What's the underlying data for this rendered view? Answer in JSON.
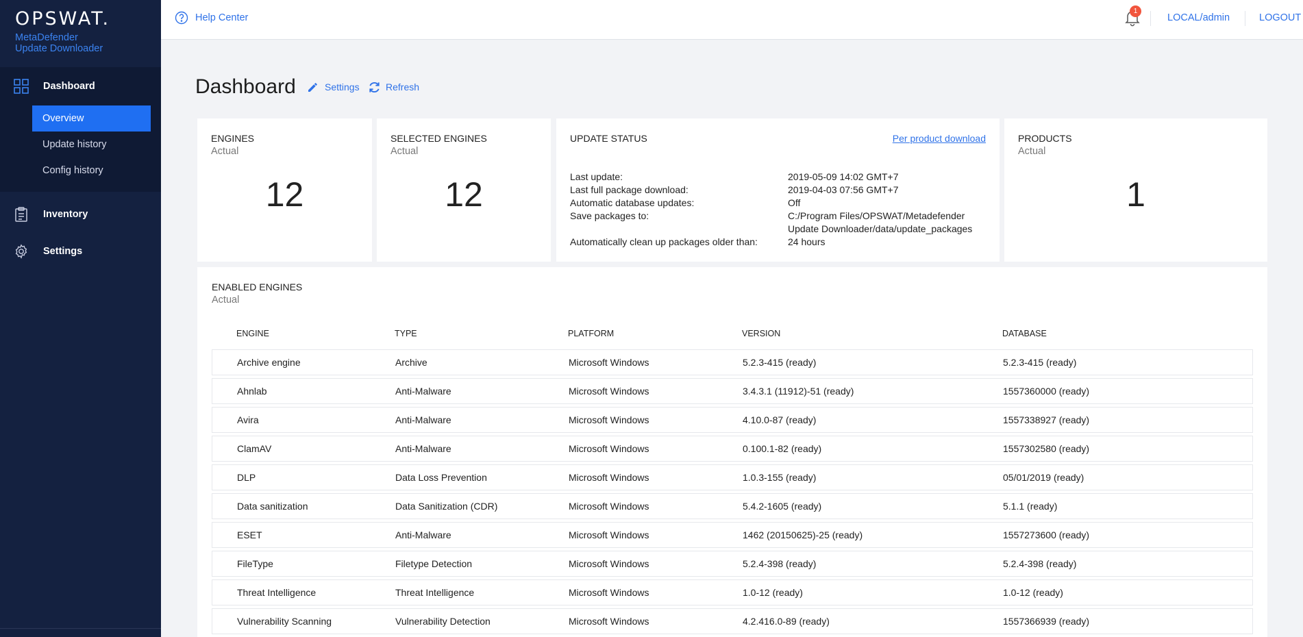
{
  "sidebar": {
    "logo": "OPSWAT.",
    "product_line1": "MetaDefender",
    "product_line2": "Update Downloader",
    "dashboard": "Dashboard",
    "sub_items": [
      "Overview",
      "Update history",
      "Config history"
    ],
    "inventory": "Inventory",
    "settings": "Settings"
  },
  "header": {
    "help": "Help Center",
    "notification_count": "1",
    "user": "LOCAL/admin",
    "logout": "LOGOUT"
  },
  "page": {
    "title": "Dashboard",
    "settings_action": "Settings",
    "refresh_action": "Refresh"
  },
  "cards": {
    "engines": {
      "title": "ENGINES",
      "sub": "Actual",
      "value": "12"
    },
    "selected": {
      "title": "SELECTED ENGINES",
      "sub": "Actual",
      "value": "12"
    },
    "update_status": {
      "title": "UPDATE STATUS",
      "link": "Per product download",
      "rows": [
        {
          "label": "Last update:",
          "value": "2019-05-09 14:02 GMT+7"
        },
        {
          "label": "Last full package download:",
          "value": "2019-04-03 07:56 GMT+7"
        },
        {
          "label": "Automatic database updates:",
          "value": "Off"
        },
        {
          "label": "Save packages to:",
          "value": "C:/Program Files/OPSWAT/Metadefender"
        },
        {
          "label": "",
          "value": "Update Downloader/data/update_packages"
        },
        {
          "label": "Automatically clean up packages older than:",
          "value": "24 hours"
        }
      ]
    },
    "products": {
      "title": "PRODUCTS",
      "sub": "Actual",
      "value": "1"
    }
  },
  "enabled_engines": {
    "title": "ENABLED ENGINES",
    "sub": "Actual",
    "columns": [
      "ENGINE",
      "TYPE",
      "PLATFORM",
      "VERSION",
      "DATABASE"
    ],
    "rows": [
      [
        "Archive engine",
        "Archive",
        "Microsoft Windows",
        "5.2.3-415 (ready)",
        "5.2.3-415 (ready)"
      ],
      [
        "Ahnlab",
        "Anti-Malware",
        "Microsoft Windows",
        "3.4.3.1 (11912)-51 (ready)",
        "1557360000 (ready)"
      ],
      [
        "Avira",
        "Anti-Malware",
        "Microsoft Windows",
        "4.10.0-87 (ready)",
        "1557338927 (ready)"
      ],
      [
        "ClamAV",
        "Anti-Malware",
        "Microsoft Windows",
        "0.100.1-82 (ready)",
        "1557302580 (ready)"
      ],
      [
        "DLP",
        "Data Loss Prevention",
        "Microsoft Windows",
        "1.0.3-155 (ready)",
        "05/01/2019 (ready)"
      ],
      [
        "Data sanitization",
        "Data Sanitization (CDR)",
        "Microsoft Windows",
        "5.4.2-1605 (ready)",
        "5.1.1 (ready)"
      ],
      [
        "ESET",
        "Anti-Malware",
        "Microsoft Windows",
        "1462 (20150625)-25 (ready)",
        "1557273600 (ready)"
      ],
      [
        "FileType",
        "Filetype Detection",
        "Microsoft Windows",
        "5.2.4-398 (ready)",
        "5.2.4-398 (ready)"
      ],
      [
        "Threat Intelligence",
        "Threat Intelligence",
        "Microsoft Windows",
        "1.0-12 (ready)",
        "1.0-12 (ready)"
      ],
      [
        "Vulnerability Scanning",
        "Vulnerability Detection",
        "Microsoft Windows",
        "4.2.416.0-89 (ready)",
        "1557366939 (ready)"
      ]
    ]
  },
  "colors": {
    "accent": "#1f6ff2",
    "sidebar": "#142140",
    "link": "#2f72e8",
    "badge": "#f1553d"
  },
  "icons": [
    "dashboard-grid-icon",
    "clipboard-icon",
    "gear-icon",
    "help-circle-icon",
    "bell-icon",
    "pencil-icon",
    "refresh-icon"
  ]
}
